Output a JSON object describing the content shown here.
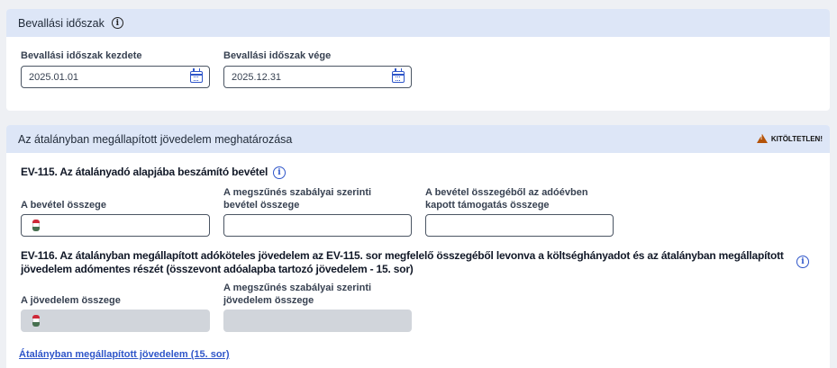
{
  "period_section": {
    "title": "Bevallási időszak",
    "start_label": "Bevallási időszak kezdete",
    "start_value": "2025.01.01",
    "end_label": "Bevallási időszak vége",
    "end_value": "2025.12.31"
  },
  "income_section": {
    "title": "Az átalányban megállapított jövedelem meghatározása",
    "status_badge": "KITÖLTETLEN!",
    "ev115": {
      "title": "EV-115. Az átalányadó alapjába beszámító bevétel",
      "field1_label": "A bevétel összege",
      "field1_value": "",
      "field2_label_line1": "A megszűnés szabályai szerinti",
      "field2_label_line2": "bevétel összege",
      "field2_value": "",
      "field3_label_line1": "A bevétel összegéből az adóévben",
      "field3_label_line2": "kapott támogatás összege",
      "field3_value": ""
    },
    "ev116": {
      "title_line1": "EV-116. Az átalányban megállapított adóköteles jövedelem az EV-115. sor megfelelő összegéből levonva a költséghányadot és az átalányban megállapított",
      "title_line2": "jövedelem adómentes részét (összevont adóalapba tartozó jövedelem - 15. sor)",
      "field1_label": "A jövedelem összege",
      "field1_value": "",
      "field2_label_line1": "A megszűnés szabályai szerinti",
      "field2_label_line2": "jövedelem összege",
      "field2_value": ""
    },
    "link_text": "Átalányban megállapított jövedelem (15. sor)"
  },
  "colors": {
    "header_bg": "#dde6f7",
    "accent_blue": "#2f56c9",
    "warning": "#b45309"
  }
}
